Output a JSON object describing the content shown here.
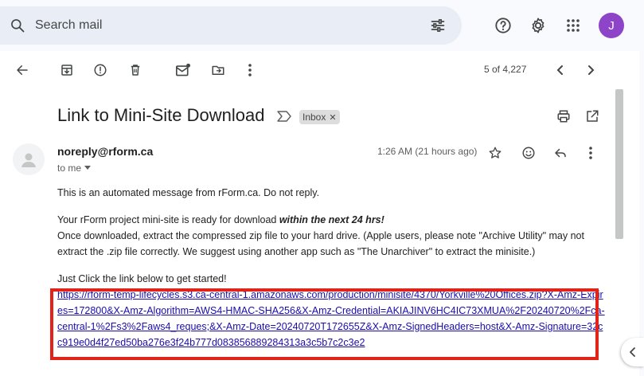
{
  "search": {
    "placeholder": "Search mail"
  },
  "user": {
    "initial": "J"
  },
  "pager": {
    "text": "5 of 4,227"
  },
  "email": {
    "subject": "Link to Mini-Site Download",
    "label": "Inbox",
    "sender": "noreply@rform.ca",
    "recipient": "to me",
    "time": "1:26 AM (21 hours ago)",
    "lines": {
      "automated": "This is an automated message from rForm.ca. Do not reply.",
      "ready_prefix": "Your rForm project mini-site is ready for download ",
      "ready_emph": "within the next 24 hrs!",
      "extract": "Once downloaded, extract the compressed zip file to your hard drive. (Apple users, please note \"Archive Utility\" may not extract the .zip file correctly. We suggest using another app such as \"The Unarchiver\" to extract the minisite.)",
      "click": "Just Click the link below to get started!",
      "link": "https://rform-temp-lifecycles.s3.ca-central-1.amazonaws.com/production/minisite/4370/Yorkville%20Offices.zip?X-Amz-Expires=172800&X-Amz-Algorithm=AWS4-HMAC-SHA256&X-Amz-Credential=AKIAJINV6HC4IC73XMUA%2F20240720%2Fca-central-1%2Fs3%2Faws4_reques;&X-Amz-Date=20240720T172655Z&X-Amz-SignedHeaders=host&X-Amz-Signature=32cc919e0d4f27ed50ba276e3f24b777d083856889284313a3c5b7c2c3e2"
    }
  },
  "colors": {
    "accent": "#1a0dab",
    "highlight": "#e2231a",
    "avatar": "#8e44c8"
  }
}
